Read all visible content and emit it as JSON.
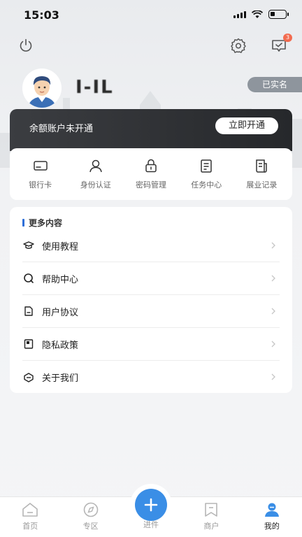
{
  "status_bar": {
    "time": "15:03",
    "battery_level": 0.3
  },
  "header": {
    "message_badge": "3"
  },
  "profile": {
    "username": "I-IL",
    "verified_label": "已实名"
  },
  "balance": {
    "text": "余额账户未开通",
    "button_label": "立即开通"
  },
  "quick_menu": [
    {
      "label": "银行卡",
      "icon": "bank-card-icon"
    },
    {
      "label": "身份认证",
      "icon": "identity-icon"
    },
    {
      "label": "密码管理",
      "icon": "lock-icon"
    },
    {
      "label": "任务中心",
      "icon": "task-icon"
    },
    {
      "label": "展业记录",
      "icon": "record-icon"
    }
  ],
  "more": {
    "title": "更多内容",
    "items": [
      {
        "label": "使用教程",
        "icon": "graduation-cap-icon"
      },
      {
        "label": "帮助中心",
        "icon": "help-icon"
      },
      {
        "label": "用户协议",
        "icon": "document-icon"
      },
      {
        "label": "隐私政策",
        "icon": "privacy-icon"
      },
      {
        "label": "关于我们",
        "icon": "about-icon"
      }
    ]
  },
  "tabs": [
    {
      "label": "首页",
      "icon": "home-icon"
    },
    {
      "label": "专区",
      "icon": "compass-icon"
    },
    {
      "label": "进件",
      "icon": "plus-icon"
    },
    {
      "label": "商户",
      "icon": "merchant-icon"
    },
    {
      "label": "我的",
      "icon": "profile-icon"
    }
  ],
  "colors": {
    "accent": "#3a8ee6",
    "badge": "#f26b4f",
    "dark_bar": "#2b2d30"
  }
}
